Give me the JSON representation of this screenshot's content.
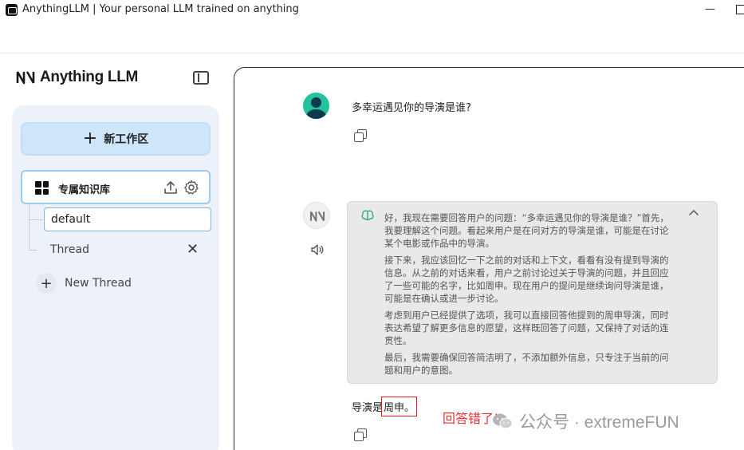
{
  "window": {
    "title": "AnythingLLM | Your personal LLM trained on anything",
    "min_glyph": "—"
  },
  "sidebar": {
    "logo_text": "Anything LLM",
    "new_workspace_label": "新工作区",
    "workspace": {
      "name": "专属知识库"
    },
    "threads": [
      {
        "label": "default"
      },
      {
        "label": "Thread"
      }
    ],
    "new_thread_label": "New Thread"
  },
  "chat": {
    "user_message": "多幸运遇见你的导演是谁?",
    "thought_paragraphs": [
      "好，我现在需要回答用户的问题：“多幸运遇见你的导演是谁？”首先，我要理解这个问题。看起来用户是在问对方的导演是谁，可能是在讨论某个电影或作品中的导演。",
      "接下来，我应该回忆一下之前的对话和上下文，看看有没有提到导演的信息。从之前的对话来看，用户之前讨论过关于导演的问题，并且回应了一些可能的名字，比如周申。现在用户的提问是继续询问导演是谁，可能是在确认或进一步讨论。",
      "考虑到用户已经提供了选项，我可以直接回答他提到的周申导演，同时表达希望了解更多信息的愿望，这样既回答了问题，又保持了对话的连贯性。",
      "最后，我需要确保回答简洁明了，不添加额外信息，只专注于当前的问题和用户的意图。"
    ],
    "answer_prefix": "导演是",
    "answer_highlight": "周申。"
  },
  "annotation": "回答错了!",
  "watermark": {
    "text": "公众号 · extremeFUN"
  },
  "colors": {
    "accent_button": "#cde6fa",
    "selected_border": "#9ccbf0",
    "annotation_red": "#e23333",
    "user_avatar": "#22c39c"
  },
  "icons": [
    "app-icon",
    "sidebar-toggle-icon",
    "plus-icon",
    "grid-icon",
    "upload-icon",
    "gear-icon",
    "close-icon",
    "copy-icon",
    "speaker-icon",
    "brain-icon",
    "chevron-up-icon",
    "wechat-icon"
  ]
}
